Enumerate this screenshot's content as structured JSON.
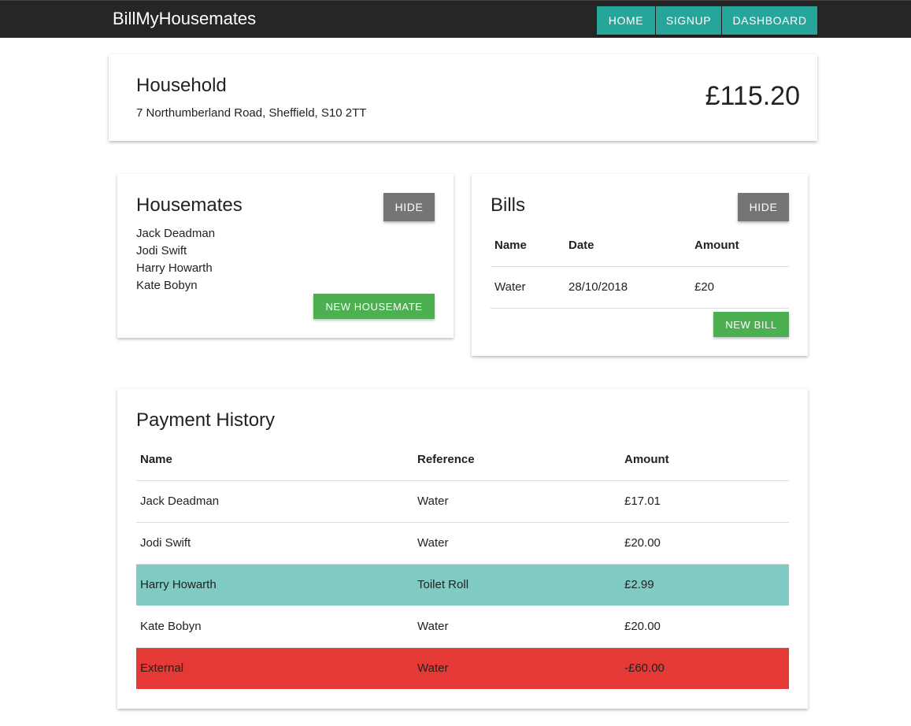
{
  "nav": {
    "brand": "BillMyHousemates",
    "home": "HOME",
    "signup": "SIGNUP",
    "dashboard": "DASHBOARD"
  },
  "household": {
    "title": "Household",
    "address": "7 Northumberland Road, Sheffield, S10 2TT",
    "total": "£115.20"
  },
  "housemates": {
    "title": "Housemates",
    "hide_label": "HIDE",
    "names": [
      "Jack Deadman",
      "Jodi Swift",
      "Harry Howarth",
      "Kate Bobyn"
    ],
    "new_label": "NEW HOUSEMATE"
  },
  "bills": {
    "title": "Bills",
    "hide_label": "HIDE",
    "headers": [
      "Name",
      "Date",
      "Amount"
    ],
    "rows": [
      [
        "Water",
        "28/10/2018",
        "£20"
      ]
    ],
    "new_label": "NEW BILL"
  },
  "payments": {
    "title": "Payment History",
    "headers": [
      "Name",
      "Reference",
      "Amount"
    ],
    "rows": [
      [
        "Jack Deadman",
        "Water",
        "£17.01"
      ],
      [
        "Jodi Swift",
        "Water",
        "£20.00"
      ],
      [
        "Harry Howarth",
        "Toilet Roll",
        "£2.99"
      ],
      [
        "Kate Bobyn",
        "Water",
        "£20.00"
      ],
      [
        "External",
        "Water",
        "-£60.00"
      ]
    ],
    "row_highlight": [
      "none",
      "none",
      "teal",
      "none",
      "red"
    ]
  },
  "colors": {
    "navbar": "#262626",
    "accent_teal": "#26a69a",
    "button_green": "#4caf50",
    "button_grey": "#757575",
    "row_teal": "#80cbc4",
    "row_red": "#e53935"
  }
}
